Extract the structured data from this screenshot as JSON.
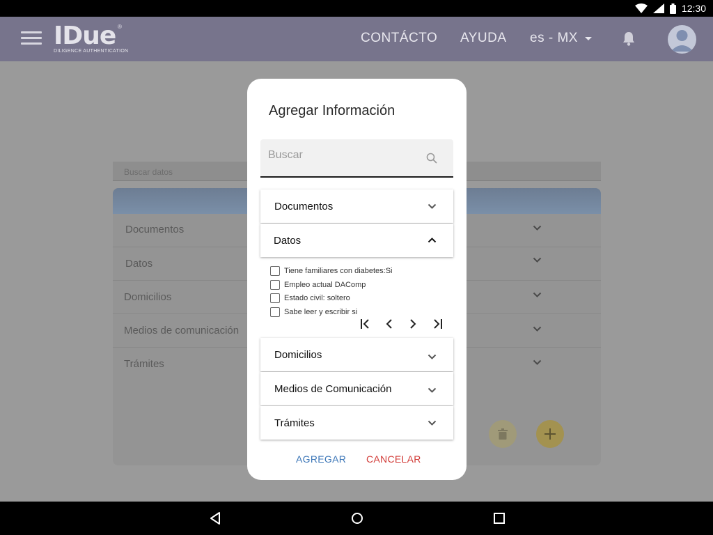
{
  "status_bar": {
    "time": "12:30"
  },
  "header": {
    "logo_text": "IDue",
    "logo_registered": "®",
    "logo_subtitle": "DILIGENCE AUTHENTICATION",
    "nav": {
      "contact": "CONTÁCTO",
      "help": "AYUDA",
      "language": "es - MX"
    }
  },
  "background": {
    "search_placeholder": "Buscar datos",
    "rows": [
      "Documentos",
      "Datos",
      "Domicilios",
      "Medios de comunicación",
      "Trámites"
    ]
  },
  "dialog": {
    "title": "Agregar Información",
    "search_placeholder": "Buscar",
    "sections": {
      "documentos": "Documentos",
      "datos": "Datos",
      "domicilios": "Domicilios",
      "medios": "Medios de Comunicación",
      "tramites": "Trámites"
    },
    "data_items": [
      "Tiene familiares con diabetes:Si",
      "Empleo actual DAComp",
      "Estado civil: soltero",
      "Sabe leer y escribir si"
    ],
    "actions": {
      "add": "AGREGAR",
      "cancel": "CANCELAR"
    }
  },
  "colors": {
    "app_bar": "#77748c",
    "accent_blue": "#3d77b8",
    "accent_red": "#d23b37",
    "fab_add": "#a39250"
  }
}
